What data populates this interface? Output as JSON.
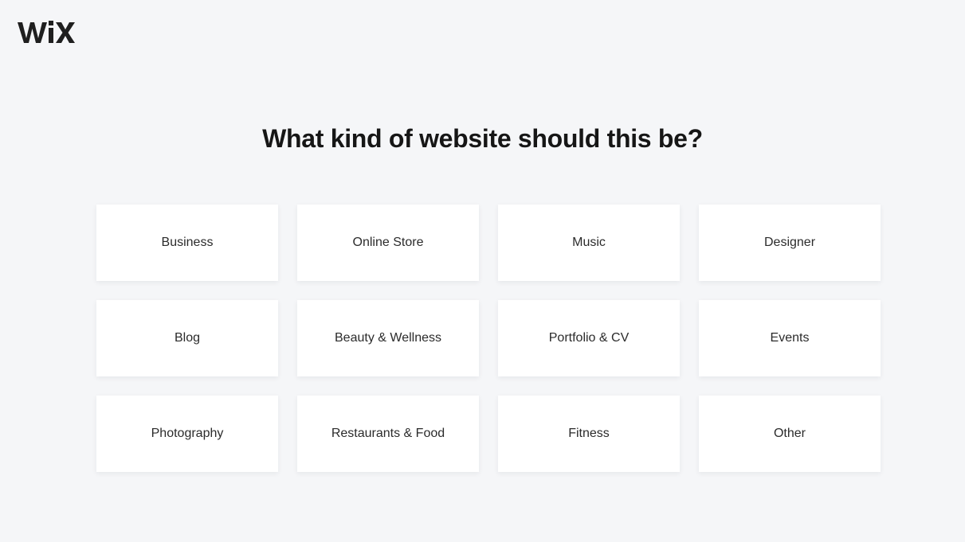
{
  "brand": {
    "logo_text": "WiX",
    "logo_icon": "wix-logo-icon"
  },
  "page": {
    "title": "What kind of website should this be?"
  },
  "categories": [
    {
      "label": "Business"
    },
    {
      "label": "Online Store"
    },
    {
      "label": "Music"
    },
    {
      "label": "Designer"
    },
    {
      "label": "Blog"
    },
    {
      "label": "Beauty & Wellness"
    },
    {
      "label": "Portfolio & CV"
    },
    {
      "label": "Events"
    },
    {
      "label": "Photography"
    },
    {
      "label": "Restaurants & Food"
    },
    {
      "label": "Fitness"
    },
    {
      "label": "Other"
    }
  ],
  "colors": {
    "background": "#f5f6f8",
    "card": "#ffffff",
    "title": "#161616",
    "logo": "#1f1f1f"
  }
}
